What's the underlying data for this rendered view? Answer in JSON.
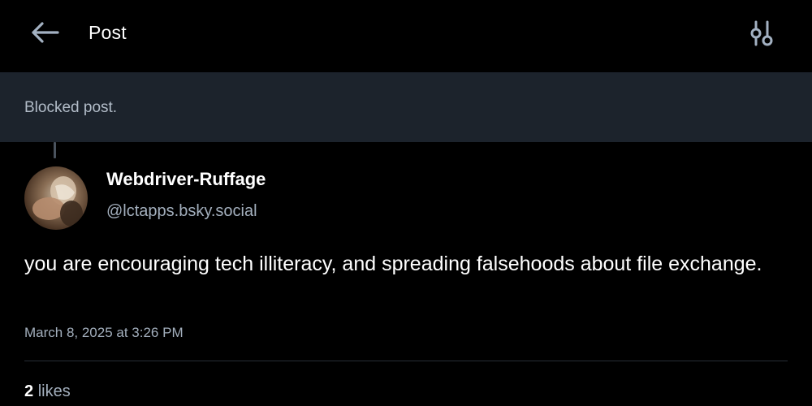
{
  "header": {
    "back_icon": "arrow-left-icon",
    "title": "Post",
    "settings_icon": "sliders-icon"
  },
  "blocked_banner": {
    "text": "Blocked post."
  },
  "post": {
    "author": {
      "display_name": "Webdriver-Ruffage",
      "handle": "@lctapps.bsky.social",
      "avatar_icon": "avatar-photo"
    },
    "text": "you are encouraging tech illiteracy, and spreading falsehoods about file exchange.",
    "timestamp": "March 8, 2025 at 3:26 PM",
    "likes_count": "2",
    "likes_label": "likes"
  },
  "colors": {
    "background": "#000000",
    "banner_background": "#1c232c",
    "muted_text": "#a3afbd",
    "primary_text": "#ffffff"
  }
}
